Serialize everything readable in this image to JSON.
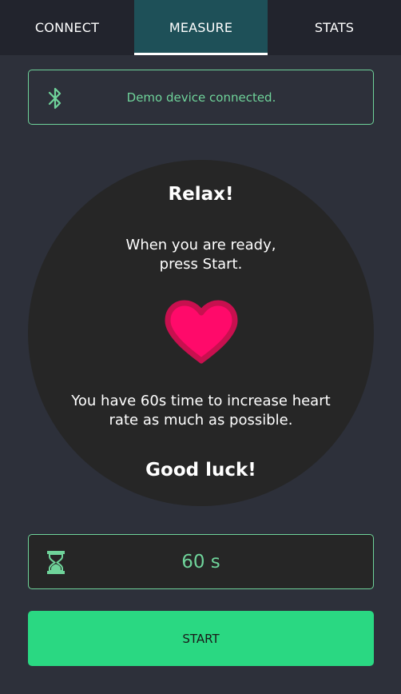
{
  "tabs": [
    {
      "label": "CONNECT",
      "active": false
    },
    {
      "label": "MEASURE",
      "active": true
    },
    {
      "label": "STATS",
      "active": false
    }
  ],
  "status": {
    "icon": "bluetooth-icon",
    "text": "Demo device connected."
  },
  "instructions": {
    "title": "Relax!",
    "line1": "When you are ready,",
    "line2": "press Start.",
    "icon": "heart-icon",
    "hint_line1": "You have 60s time to increase heart",
    "hint_line2": "rate as much as possible.",
    "closing": "Good luck!"
  },
  "timer": {
    "icon": "hourglass-icon",
    "value": "60 s"
  },
  "start_button": {
    "label": "START"
  },
  "colors": {
    "background": "#2d303a",
    "tabbar": "#22242d",
    "active_tab": "#1e5058",
    "accent_green": "#6fd39a",
    "button_green": "#2ad882",
    "heart_fill": "#ff0a6a",
    "heart_outline": "#c8104f",
    "panel": "#262626"
  }
}
